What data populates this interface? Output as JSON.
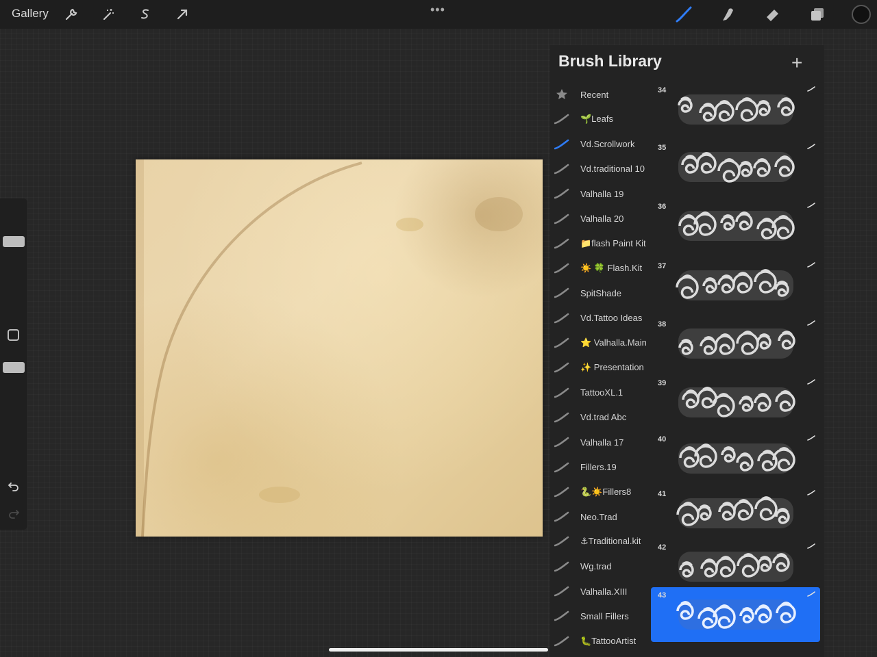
{
  "topbar": {
    "gallery_label": "Gallery",
    "more_label": "•••",
    "left_tools": [
      "wrench-icon",
      "magic-wand-icon",
      "selection-icon",
      "transform-arrow-icon"
    ],
    "right_tools": [
      "brush-icon",
      "smudge-icon",
      "eraser-icon",
      "layers-icon"
    ],
    "active_tool": "brush-icon",
    "accent": "#2f7cf6",
    "current_color": "#111111"
  },
  "library": {
    "title": "Brush Library",
    "add_label": "+",
    "sets": [
      {
        "label": "Recent",
        "icon": "star-icon"
      },
      {
        "label": "🌱Leafs",
        "icon": "brush-stroke-icon"
      },
      {
        "label": "Vd.Scrollwork",
        "icon": "brush-stroke-icon",
        "selected": true
      },
      {
        "label": "Vd.traditional 10",
        "icon": "brush-stroke-icon"
      },
      {
        "label": "Valhalla 19",
        "icon": "brush-stroke-icon"
      },
      {
        "label": "Valhalla 20",
        "icon": "brush-stroke-icon"
      },
      {
        "label": "📁flash Paint Kit",
        "icon": "brush-stroke-icon"
      },
      {
        "label": "☀️ 🍀 Flash.Kit",
        "icon": "brush-stroke-icon"
      },
      {
        "label": "SpitShade",
        "icon": "brush-stroke-icon"
      },
      {
        "label": "Vd.Tattoo Ideas",
        "icon": "brush-stroke-icon"
      },
      {
        "label": "⭐ Valhalla.Main",
        "icon": "brush-stroke-icon"
      },
      {
        "label": "✨ Presentation",
        "icon": "brush-stroke-icon"
      },
      {
        "label": "TattooXL.1",
        "icon": "brush-stroke-icon"
      },
      {
        "label": "Vd.trad Abc",
        "icon": "brush-stroke-icon"
      },
      {
        "label": "Valhalla 17",
        "icon": "brush-stroke-icon"
      },
      {
        "label": "Fillers.19",
        "icon": "brush-stroke-icon"
      },
      {
        "label": "🐍☀️Fillers8",
        "icon": "brush-stroke-icon"
      },
      {
        "label": "Neo.Trad",
        "icon": "brush-stroke-icon"
      },
      {
        "label": "⚓Traditional.kit",
        "icon": "brush-stroke-icon"
      },
      {
        "label": "Wg.trad",
        "icon": "brush-stroke-icon"
      },
      {
        "label": "Valhalla.XIII",
        "icon": "brush-stroke-icon"
      },
      {
        "label": "Small Fillers",
        "icon": "brush-stroke-icon"
      },
      {
        "label": "🐛TattooArtist",
        "icon": "brush-stroke-icon"
      }
    ],
    "brushes": [
      {
        "number": "34"
      },
      {
        "number": "35"
      },
      {
        "number": "36"
      },
      {
        "number": "37"
      },
      {
        "number": "38"
      },
      {
        "number": "39"
      },
      {
        "number": "40"
      },
      {
        "number": "41"
      },
      {
        "number": "42"
      },
      {
        "number": "43",
        "selected": true
      }
    ]
  }
}
